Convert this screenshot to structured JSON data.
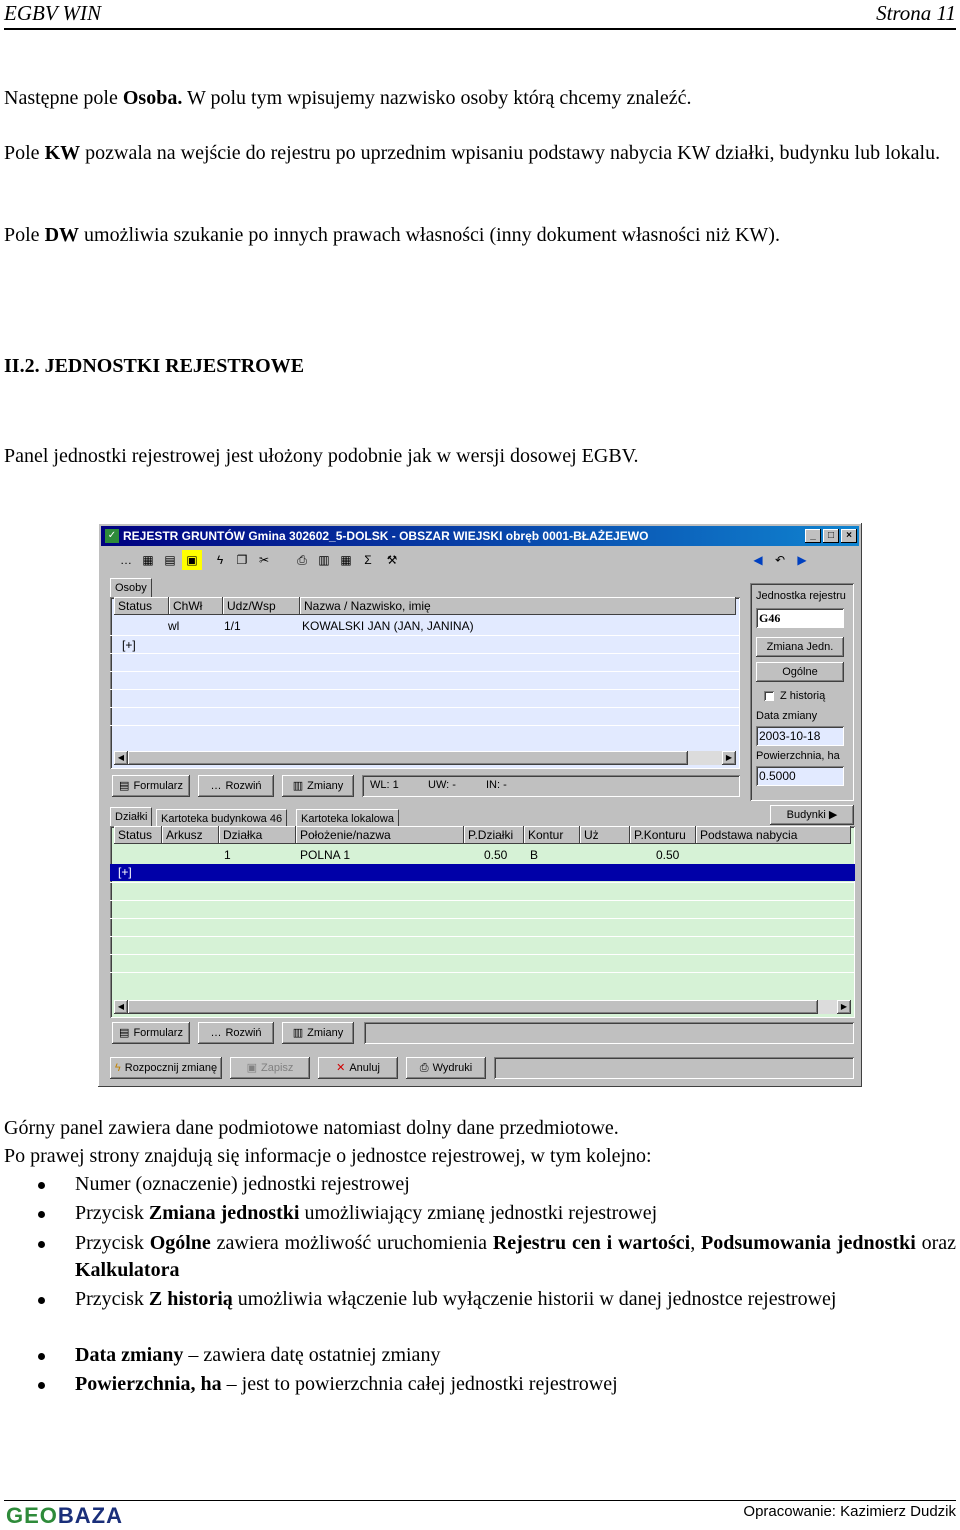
{
  "header": {
    "left": "EGBV WIN",
    "right": "Strona 11"
  },
  "paras": {
    "p1_a": "Następne pole ",
    "p1_b": "Osoba.",
    "p1_c": " W polu tym wpisujemy nazwisko osoby którą chcemy znaleźć.",
    "p2_a": "Pole ",
    "p2_b": "KW",
    "p2_c": " pozwala na wejście do rejestru po uprzednim wpisaniu podstawy nabycia KW działki, budynku lub lokalu.",
    "p3_a": "Pole ",
    "p3_b": "DW",
    "p3_c": " umożliwia szukanie po innych prawach własności (inny dokument własności niż KW).",
    "heading": "II.2. JEDNOSTKI REJESTROWE",
    "p4": "Panel jednostki rejestrowej jest ułożony podobnie jak w wersji dosowej EGBV.",
    "p5": "Górny panel zawiera dane podmiotowe natomiast dolny dane przedmiotowe.",
    "p6": "Po prawej strony znajdują się informacje o jednostce rejestrowej, w tym kolejno:"
  },
  "bullets": {
    "b1": "Numer (oznaczenie) jednostki rejestrowej",
    "b2_a": "Przycisk ",
    "b2_b": "Zmiana jednostki",
    "b2_c": " umożliwiający zmianę jednostki rejestrowej",
    "b3_a": "Przycisk ",
    "b3_b": "Ogólne",
    "b3_c": " zawiera możliwość uruchomienia ",
    "b3_d": "Rejestru cen i wartości",
    "b3_e": ", ",
    "b3_f": "Podsumowania jednostki",
    "b3_g": " oraz ",
    "b3_h": "Kalkulatora",
    "b4_a": "Przycisk ",
    "b4_b": "Z historią",
    "b4_c": " umożliwia włączenie lub wyłączenie historii w danej jednostce rejestrowej",
    "b5_a": "Data zmiany",
    "b5_b": " – zawiera datę ostatniej zmiany",
    "b6_a": "Powierzchnia, ha",
    "b6_b": " – jest to powierzchnia całej jednostki rejestrowej"
  },
  "footer": {
    "logo_a": "GEO",
    "logo_b": "BAZA",
    "right": "Opracowanie: Kazimierz Dudzik"
  },
  "app": {
    "title": "REJESTR GRUNTÓW  Gmina 302602_5-DOLSK - OBSZAR WIEJSKI obręb 0001-BŁAŻEJEWO",
    "window_buttons": [
      "_",
      "□",
      "×"
    ],
    "upper": {
      "tab": "Osoby",
      "columns": [
        "Status",
        "ChWł",
        "Udz/Wsp",
        "Nazwa / Nazwisko, imię"
      ],
      "row": [
        "",
        "wl",
        "1/1",
        "KOWALSKI JAN (JAN, JANINA)"
      ],
      "plus": "[+]",
      "buttons": {
        "formularz": "Formularz",
        "rozwin": "Rozwiń",
        "zmiany": "Zmiany"
      },
      "status": {
        "wl": "WL: 1",
        "uw": "UW: -",
        "in": "IN: -"
      }
    },
    "side": {
      "jr_label": "Jednostka rejestru",
      "jr_value": "G46",
      "zmiana_btn": "Zmiana Jedn.",
      "ogolne_btn": "Ogólne",
      "historia": "Z historią",
      "data_label": "Data zmiany",
      "data_value": "2003-10-18",
      "pow_label": "Powierzchnia, ha",
      "pow_value": "0.5000",
      "budynki_btn": "Budynki"
    },
    "lower": {
      "tabs": [
        "Działki",
        "Kartoteka budynkowa 46",
        "Kartoteka lokalowa"
      ],
      "columns": [
        "Status",
        "Arkusz",
        "Działka",
        "Położenie/nazwa",
        "P.Działki",
        "Kontur",
        "Uż",
        "P.Konturu",
        "Podstawa nabycia"
      ],
      "row": [
        "",
        "",
        "1",
        "POLNA 1",
        "0.50",
        "B",
        "",
        "0.50",
        ""
      ],
      "plus": "[+]",
      "buttons": {
        "formularz": "Formularz",
        "rozwin": "Rozwiń",
        "zmiany": "Zmiany"
      }
    },
    "bottom": {
      "rozpocznij": "Rozpocznij zmianę",
      "zapisz": "Zapisz",
      "anuluj": "Anuluj",
      "wydruki": "Wydruki"
    },
    "colors": {
      "title_start": "#000080",
      "upper_grid": "#e2eaff",
      "lower_grid": "#d6f2d6",
      "selection": "#0000a8"
    }
  }
}
